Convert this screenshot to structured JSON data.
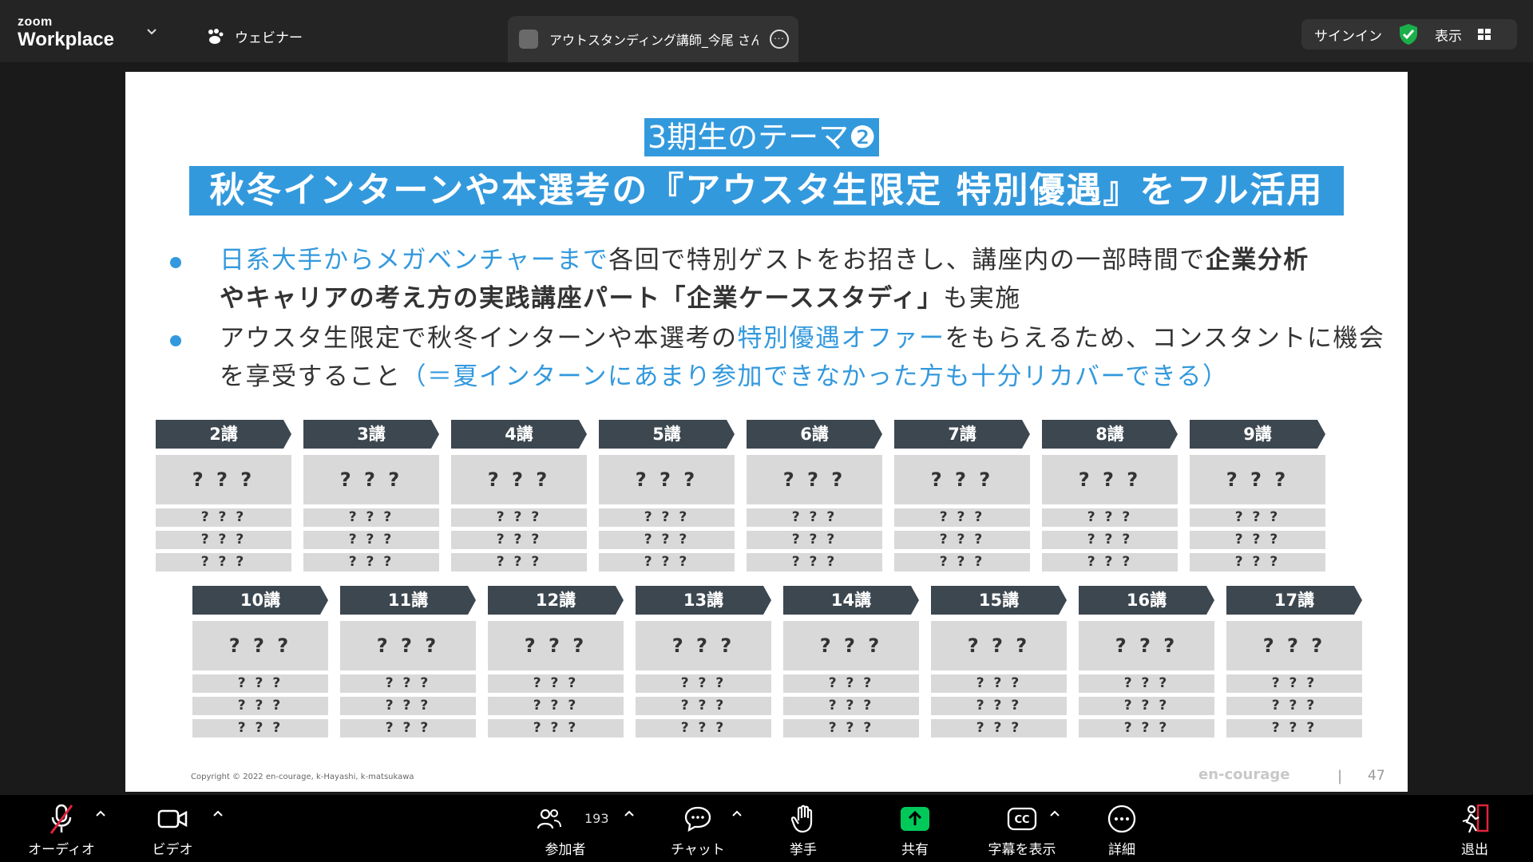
{
  "topbar": {
    "brand_small": "zoom",
    "brand_large": "Workplace",
    "webinar_label": "ウェビナー",
    "meeting_title": "アウトスタンディング講師_今尾 さんの",
    "signin_label": "サインイン",
    "view_label": "表示"
  },
  "slide": {
    "theme_tag": "3期生のテーマ❷",
    "headline": "秋冬インターンや本選考の『アウスタ生限定 特別優遇』をフル活用",
    "bullet1": {
      "part1": "日系大手からメガベンチャーまで",
      "part2": "各回で特別ゲストをお招きし、講座内の一部時間で",
      "part3": "企業分析",
      "part4": "やキャリアの考え方の実践講座パート「企業ケーススタディ」",
      "part5": "も実施"
    },
    "bullet2": {
      "part1": "アウスタ生限定で秋冬インターンや本選考の",
      "part2": "特別優遇オファー",
      "part3": "をもらえるため、コンスタントに機会を享受すること",
      "part4": "（＝夏インターンにあまり参加できなかった方も十分リカバーできる）"
    },
    "lessons": [
      {
        "label": "2講",
        "title": "? ? ?",
        "items": [
          "? ? ?",
          "? ? ?",
          "? ? ?"
        ]
      },
      {
        "label": "3講",
        "title": "? ? ?",
        "items": [
          "? ? ?",
          "? ? ?",
          "? ? ?"
        ]
      },
      {
        "label": "4講",
        "title": "? ? ?",
        "items": [
          "? ? ?",
          "? ? ?",
          "? ? ?"
        ]
      },
      {
        "label": "5講",
        "title": "? ? ?",
        "items": [
          "? ? ?",
          "? ? ?",
          "? ? ?"
        ]
      },
      {
        "label": "6講",
        "title": "? ? ?",
        "items": [
          "? ? ?",
          "? ? ?",
          "? ? ?"
        ]
      },
      {
        "label": "7講",
        "title": "? ? ?",
        "items": [
          "? ? ?",
          "? ? ?",
          "? ? ?"
        ]
      },
      {
        "label": "8講",
        "title": "? ? ?",
        "items": [
          "? ? ?",
          "? ? ?",
          "? ? ?"
        ]
      },
      {
        "label": "9講",
        "title": "? ? ?",
        "items": [
          "? ? ?",
          "? ? ?",
          "? ? ?"
        ]
      },
      {
        "label": "10講",
        "title": "? ? ?",
        "items": [
          "? ? ?",
          "? ? ?",
          "? ? ?"
        ]
      },
      {
        "label": "11講",
        "title": "? ? ?",
        "items": [
          "? ? ?",
          "? ? ?",
          "? ? ?"
        ]
      },
      {
        "label": "12講",
        "title": "? ? ?",
        "items": [
          "? ? ?",
          "? ? ?",
          "? ? ?"
        ]
      },
      {
        "label": "13講",
        "title": "? ? ?",
        "items": [
          "? ? ?",
          "? ? ?",
          "? ? ?"
        ]
      },
      {
        "label": "14講",
        "title": "? ? ?",
        "items": [
          "? ? ?",
          "? ? ?",
          "? ? ?"
        ]
      },
      {
        "label": "15講",
        "title": "? ? ?",
        "items": [
          "? ? ?",
          "? ? ?",
          "? ? ?"
        ]
      },
      {
        "label": "16講",
        "title": "? ? ?",
        "items": [
          "? ? ?",
          "? ? ?",
          "? ? ?"
        ]
      },
      {
        "label": "17講",
        "title": "? ? ?",
        "items": [
          "? ? ?",
          "? ? ?",
          "? ? ?"
        ]
      }
    ],
    "copyright": "Copyright © 2022 en-courage, k-Hayashi, k-matsukawa",
    "logo_text": "en-courage",
    "page_separator": "|",
    "page_number": "47"
  },
  "toolbar": {
    "audio": "オーディオ",
    "video": "ビデオ",
    "participants": "参加者",
    "participants_count": "193",
    "chat": "チャット",
    "raise_hand": "挙手",
    "share": "共有",
    "captions": "字幕を表示",
    "more": "詳細",
    "leave": "退出"
  },
  "colors": {
    "accent_blue": "#3399dd",
    "lesson_header": "#3c4750",
    "placeholder_gray": "#d9d9d9",
    "share_green": "#00c95a",
    "leave_red": "#e0243a"
  },
  "icons": [
    "chevron-down-icon",
    "paw-icon",
    "more-icon",
    "shield-check-icon",
    "grid-icon",
    "mic-muted-icon",
    "camera-icon",
    "people-icon",
    "chat-icon",
    "hand-icon",
    "share-up-icon",
    "cc-icon",
    "ellipsis-icon",
    "leave-icon"
  ]
}
